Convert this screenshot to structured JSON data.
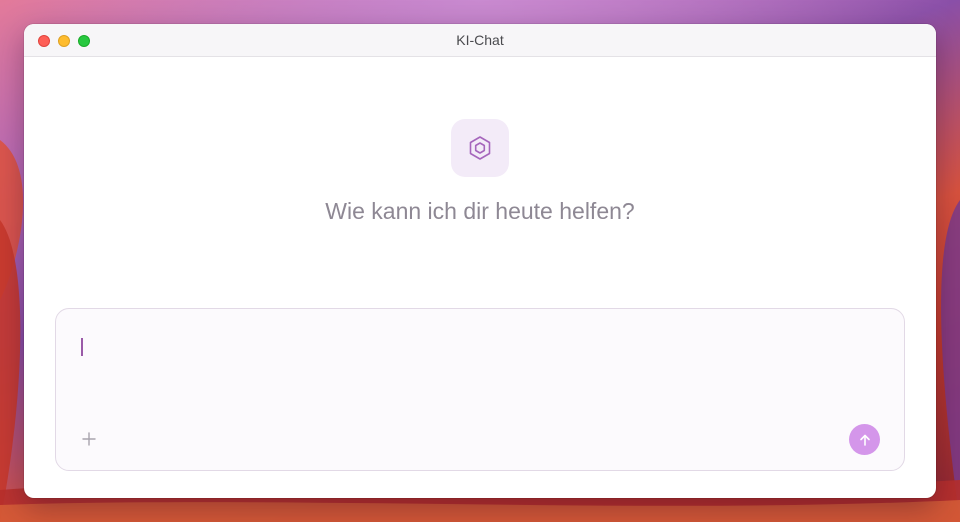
{
  "window": {
    "title": "KI-Chat"
  },
  "hero": {
    "icon": "hexagon-icon",
    "greeting": "Wie kann ich dir heute helfen?"
  },
  "composer": {
    "value": "",
    "placeholder": "",
    "attach_icon": "plus-icon",
    "send_icon": "arrow-up-icon"
  },
  "colors": {
    "accent": "#d496ea",
    "hero_icon_bg": "#f3ebf8",
    "hero_icon_stroke": "#a565bc",
    "greeting_text": "#8e8894"
  }
}
